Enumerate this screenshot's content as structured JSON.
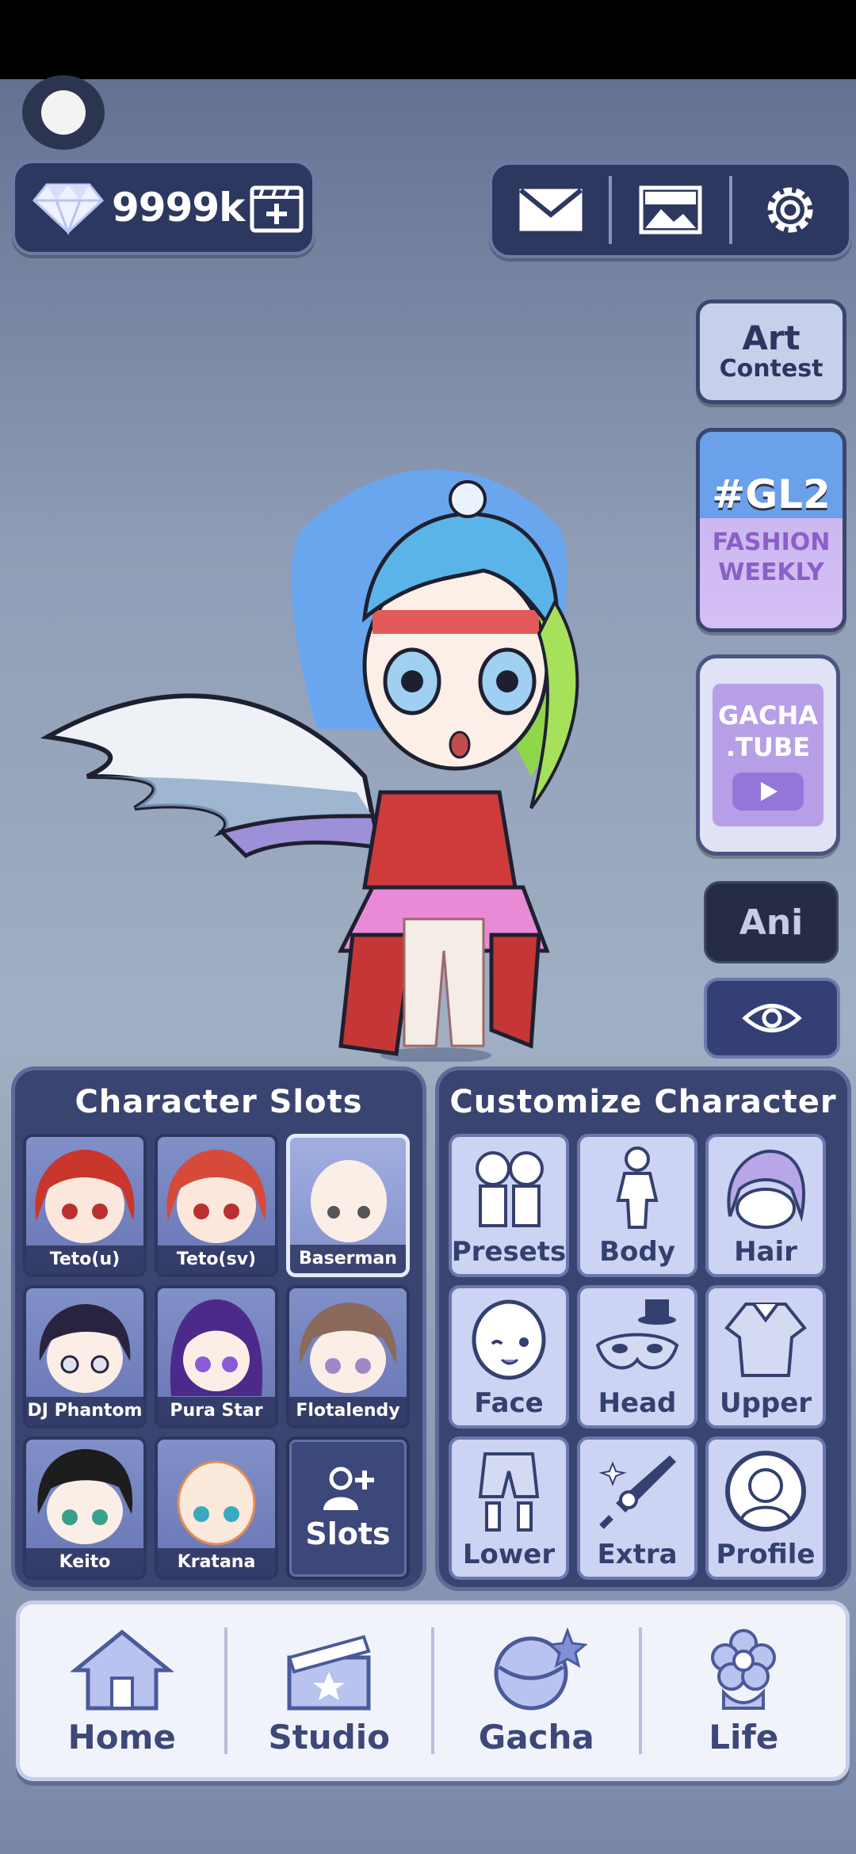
{
  "currency": {
    "amount": "9999k",
    "icon": "diamond-icon",
    "add_icon": "add-video-icon"
  },
  "top_buttons": [
    {
      "name": "mail",
      "icon": "mail-icon"
    },
    {
      "name": "gallery",
      "icon": "image-icon"
    },
    {
      "name": "settings",
      "icon": "gear-icon"
    }
  ],
  "side": {
    "art_contest": {
      "line1": "Art",
      "line2": "Contest"
    },
    "fashion_weekly": {
      "tag": "#GL2",
      "line1": "FASHION",
      "line2": "WEEKLY"
    },
    "gacha_tube": {
      "line1": "GACHA",
      "line2": ".TUBE"
    },
    "ani_label": "Ani",
    "eye_icon": "eye-icon"
  },
  "character_slots": {
    "title": "Character Slots",
    "slots": [
      {
        "name": "Teto(u)",
        "hair": "#c8362c",
        "skin": "#fbe7dc",
        "eye": "#b93030"
      },
      {
        "name": "Teto(sv)",
        "hair": "#d64a3a",
        "skin": "#fbe7dc",
        "eye": "#b93030"
      },
      {
        "name": "Baserman",
        "hair": "none",
        "skin": "#fbeee6",
        "eye": "#555555",
        "selected": true
      },
      {
        "name": "DJ Phantom",
        "hair": "#2a2340",
        "skin": "#fbeee6",
        "eye": "#dfe3ea"
      },
      {
        "name": "Pura Star",
        "hair": "#4c2a8a",
        "skin": "#fbeee6",
        "eye": "#8a5ad8"
      },
      {
        "name": "Flotalendy",
        "hair": "#8a6a5a",
        "skin": "#fbeee6",
        "eye": "#9e89c8"
      },
      {
        "name": "Keito",
        "hair": "#1d1d1d",
        "skin": "#fbeee6",
        "eye": "#3aa08a"
      },
      {
        "name": "Kratana",
        "hair": "none",
        "skin": "#fbe9dc",
        "eye": "#39a9c0"
      }
    ],
    "add_label": "Slots",
    "add_icon": "add-user-icon"
  },
  "customize": {
    "title": "Customize Character",
    "items": [
      {
        "label": "Presets",
        "icon": "presets-icon"
      },
      {
        "label": "Body",
        "icon": "body-icon"
      },
      {
        "label": "Hair",
        "icon": "hair-icon"
      },
      {
        "label": "Face",
        "icon": "face-icon"
      },
      {
        "label": "Head",
        "icon": "mask-hat-icon"
      },
      {
        "label": "Upper",
        "icon": "shirt-icon"
      },
      {
        "label": "Lower",
        "icon": "shorts-icon"
      },
      {
        "label": "Extra",
        "icon": "sword-icon"
      },
      {
        "label": "Profile",
        "icon": "profile-icon"
      }
    ]
  },
  "nav": [
    {
      "label": "Home",
      "icon": "house-icon"
    },
    {
      "label": "Studio",
      "icon": "clapperboard-icon"
    },
    {
      "label": "Gacha",
      "icon": "gacha-ball-icon"
    },
    {
      "label": "Life",
      "icon": "flower-icon"
    }
  ]
}
